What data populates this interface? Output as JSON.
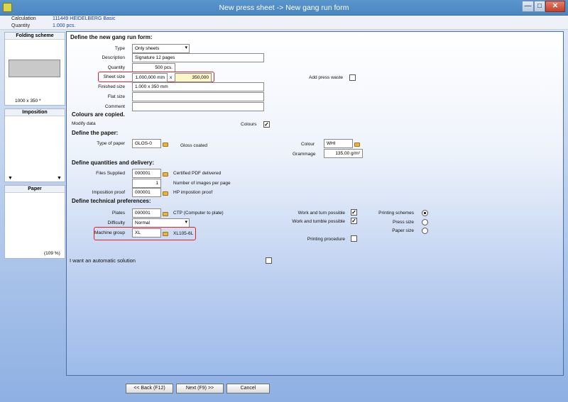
{
  "window": {
    "title": "New press sheet -> New gang run form",
    "minimize": "—",
    "maximize": "□",
    "close": "✕"
  },
  "info": {
    "calculation_label": "Calculation",
    "calculation_value": "111449 HEIDELBERG Basic",
    "quantity_label": "Quantity",
    "quantity_value": "1.000 pcs."
  },
  "sidebar": {
    "folding_scheme": {
      "title": "Folding scheme",
      "size": "1000 x 350 *"
    },
    "imposition": {
      "title": "Imposition"
    },
    "paper": {
      "title": "Paper",
      "zoom": "(109 %)"
    }
  },
  "form": {
    "define_section": "Define the new gang run form:",
    "type_label": "Type",
    "type_value": "Only sheets",
    "description_label": "Description",
    "description_value": "Signature 12 pages",
    "quantity_label": "Quantity",
    "quantity_value": "500 pcs.",
    "sheet_size_label": "Sheet size",
    "sheet_width": "1.000,000 mm",
    "sheet_x": "x",
    "sheet_height": "350,000",
    "add_press_waste_label": "Add press waste",
    "finished_size_label": "Finished size",
    "finished_size_value": "1.000 x 350 mm",
    "flat_size_label": "Flat size",
    "comment_label": "Comment",
    "colours_section": "Colours are copied.",
    "modify_data_label": "Modify data",
    "colours_label": "Colours",
    "paper_section": "Define the paper:",
    "type_of_paper_label": "Type of paper",
    "type_of_paper_value": "GLOS-0",
    "type_of_paper_desc": "Gloss coated",
    "colour_label": "Colour",
    "colour_value": "WHI",
    "grammage_label": "Grammage",
    "grammage_value": "135,00 g/m²",
    "quantities_section": "Define quantities and delivery:",
    "files_supplied_label": "Files Supplied",
    "files_supplied_value": "000001",
    "files_supplied_desc": "Certified PDF delivered",
    "images_per_page_value": "1",
    "images_per_page_desc": "Number of images per page",
    "imposition_proof_label": "Imposition proof",
    "imposition_proof_value": "000001",
    "imposition_proof_desc": "HP impostion proof",
    "technical_section": "Define technical preferences:",
    "plates_label": "Plates",
    "plates_value": "000001",
    "plates_desc": "CTP (Computer to plate)",
    "difficulty_label": "Difficulty",
    "difficulty_value": "Normal",
    "machine_group_label": "Machine group",
    "machine_group_value": "XL",
    "machine_group_desc": "XL105-6L",
    "work_turn_label": "Work and turn possible",
    "work_tumble_label": "Work and tumble possible",
    "printing_procedure_label": "Printing procedure",
    "printing_schemes_label": "Printing schemes",
    "press_size_label": "Press size",
    "paper_size_label": "Paper size",
    "automatic_label": "I want an automatic solution"
  },
  "buttons": {
    "back": "<< Back (F12)",
    "next": "Next (F9) >>",
    "cancel": "Cancel"
  }
}
